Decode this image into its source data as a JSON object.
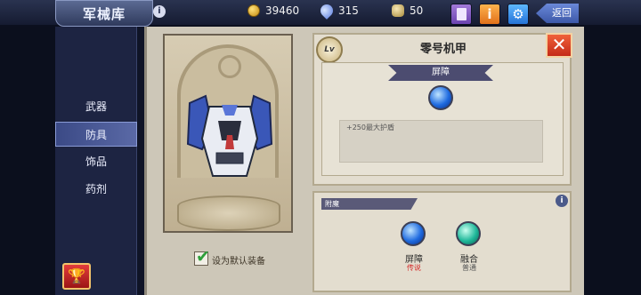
{
  "header": {
    "title": "军械库",
    "info_icon": "i",
    "gold": "39460",
    "gems": "315",
    "shards": "50",
    "back_label": "返回",
    "icons": [
      "book-icon",
      "info-icon",
      "gear-icon",
      "back-arrow-icon"
    ]
  },
  "sidebar": {
    "items": [
      {
        "label": "武器"
      },
      {
        "label": "防具"
      },
      {
        "label": "饰品"
      },
      {
        "label": "药剂"
      }
    ],
    "active_index": 1
  },
  "item": {
    "level_badge": "Lv",
    "name": "零号机甲",
    "property_banner": "屏障",
    "description": "+250最大护盾",
    "default_checkbox_label": "设为默认装备",
    "checked": true
  },
  "enchant": {
    "label": "附魔",
    "slots": [
      {
        "name": "屏障",
        "rarity": "传说",
        "rarity_color": "#d42b2b",
        "orb": "blue"
      },
      {
        "name": "融合",
        "rarity": "普通",
        "rarity_color": "#555555",
        "orb": "teal"
      }
    ]
  },
  "colors": {
    "accent_dark": "#1d2442",
    "panel": "#e3ddcf",
    "close": "#d8432a"
  }
}
